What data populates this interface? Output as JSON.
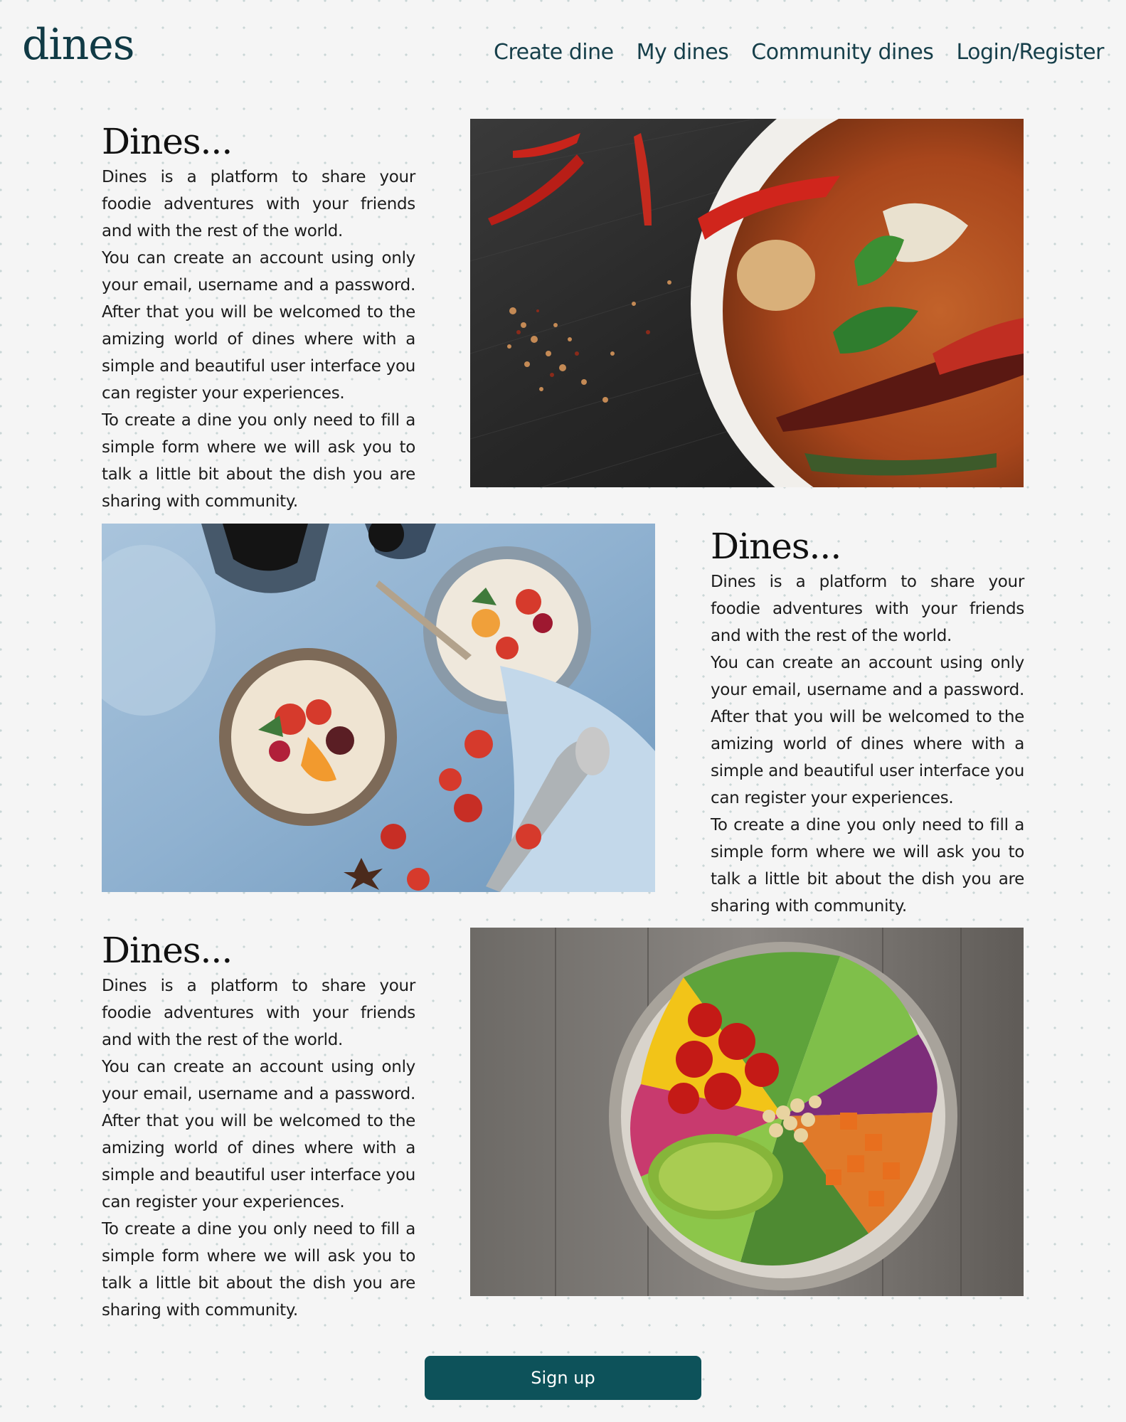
{
  "header": {
    "logo": "dines",
    "nav": [
      "Create dine",
      "My dines",
      "Community dines",
      "Login/Register"
    ]
  },
  "sections": [
    {
      "title": "Dines...",
      "paragraphs": [
        "Dines is a platform to share your foodie adventures with your friends and with the rest of the world.",
        "You can create an account using only your email, username and a password. After that you will be welcomed to the amizing world of dines where with a simple and beautiful user interface you can register your experiences.",
        "To create a dine you only need to fill a simple form where we will ask you to talk a little bit about the dish you are sharing with community."
      ],
      "image": "curry-bowl-photo"
    },
    {
      "title": "Dines...",
      "paragraphs": [
        "Dines is a platform to share your foodie adventures with your friends and with the rest of the world.",
        "You can create an account using only your email, username and a password. After that you will be welcomed to the amizing world of dines where with a simple and beautiful user interface you can register your experiences.",
        "To create a dine you only need to fill a simple form where we will ask you to talk a little bit about the dish you are sharing with community."
      ],
      "image": "porridge-bowls-photo"
    },
    {
      "title": "Dines...",
      "paragraphs": [
        "Dines is a platform to share your foodie adventures with your friends and with the rest of the world.",
        "You can create an account using only your email, username and a password. After that you will be welcomed to the amizing world of dines where with a simple and beautiful user interface you can register your experiences.",
        "To create a dine you only need to fill a simple form where we will ask you to talk a little bit about the dish you are sharing with community."
      ],
      "image": "salad-bowl-photo"
    }
  ],
  "signup": {
    "label": "Sign up"
  },
  "colors": {
    "brand": "#0d525a",
    "nav": "#163f4a",
    "background": "#f5f5f5"
  }
}
